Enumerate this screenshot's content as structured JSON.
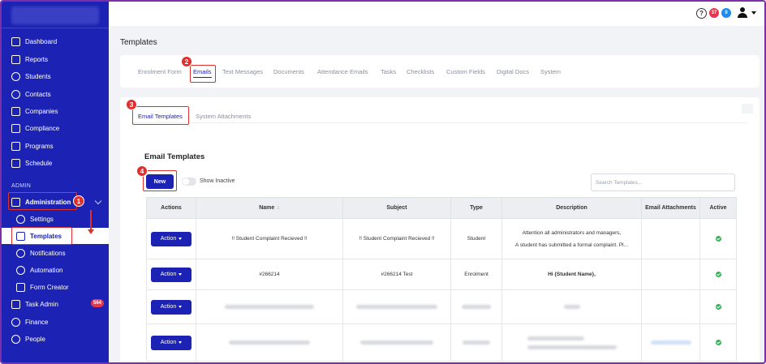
{
  "sidebar": {
    "items": [
      {
        "label": "Dashboard"
      },
      {
        "label": "Reports"
      },
      {
        "label": "Students"
      },
      {
        "label": "Contacts"
      },
      {
        "label": "Companies"
      },
      {
        "label": "Compliance"
      },
      {
        "label": "Programs"
      },
      {
        "label": "Schedule"
      }
    ],
    "section_label": "ADMIN",
    "admin": {
      "label": "Administration"
    },
    "sub_items": [
      {
        "label": "Settings"
      },
      {
        "label": "Templates"
      },
      {
        "label": "Notifications"
      },
      {
        "label": "Automation"
      },
      {
        "label": "Form Creator"
      }
    ],
    "bottom_items": [
      {
        "label": "Task Admin",
        "badge": "564"
      },
      {
        "label": "Finance"
      },
      {
        "label": "People"
      }
    ]
  },
  "topbar": {
    "help": "?",
    "badge_red": "37",
    "badge_blue": "0",
    "badge_red_color": "#e8344e",
    "badge_blue_color": "#1d8cf0"
  },
  "page_title": "Templates",
  "tabs": [
    {
      "label": "Enrolment Form"
    },
    {
      "label": "Emails"
    },
    {
      "label": "Text Messages"
    },
    {
      "label": "Documents"
    },
    {
      "label": "Attendance Emails"
    },
    {
      "label": "Tasks"
    },
    {
      "label": "Checklists"
    },
    {
      "label": "Custom Fields"
    },
    {
      "label": "Digital Docs"
    },
    {
      "label": "System"
    }
  ],
  "subtabs": [
    {
      "label": "Email Templates"
    },
    {
      "label": "System Attachments"
    }
  ],
  "section_title": "Email Templates",
  "new_label": "New",
  "show_inactive_label": "Show Inactive",
  "search": {
    "placeholder": "Search Templates..."
  },
  "table": {
    "headers": [
      "Actions",
      "Name",
      "Subject",
      "Type",
      "Description",
      "Email Attachments",
      "Active"
    ],
    "sort_indicator": "↕",
    "action_label": "Action",
    "rows": [
      {
        "name": "!! Student Complaint Recieved !!",
        "subject": "!! Student Complaint Recieved !!",
        "type": "Student",
        "description_1": "Attention all administrators and managers,",
        "description_2": "A student has submitted a formal complaint. Pl...",
        "active": true
      },
      {
        "name": "#266214",
        "subject": "#266214 Test",
        "type": "Enrolment",
        "description_1": "Hi {Student Name},",
        "active": true
      },
      {
        "blurred": true,
        "active": true
      },
      {
        "blurred": true,
        "active": true
      }
    ]
  },
  "annotations": [
    "1",
    "2",
    "3",
    "4"
  ],
  "accent_color": "#1c23b4",
  "annotation_color": "#e0302e"
}
